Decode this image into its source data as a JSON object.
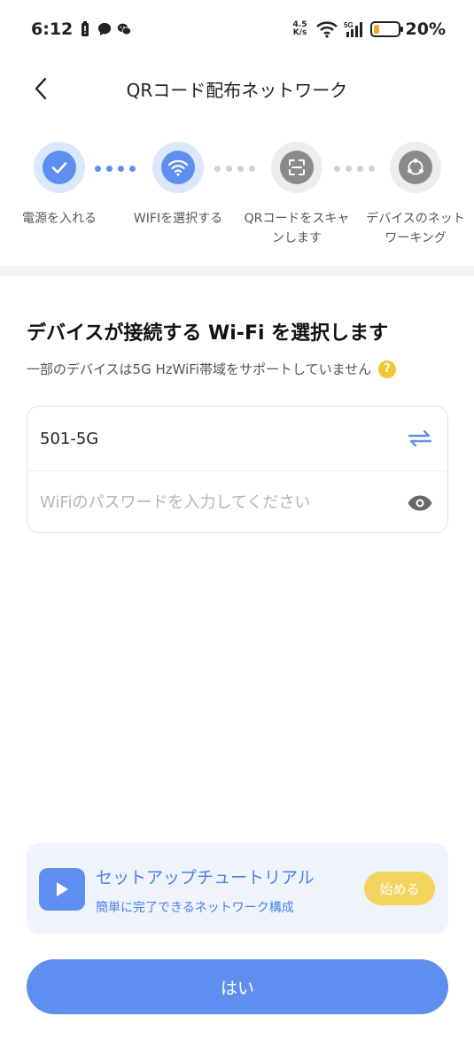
{
  "status_bar": {
    "time": "6:12",
    "net_speed_value": "4.5",
    "net_speed_unit": "K/s",
    "battery_percent": "20%",
    "battery_level": 0.2,
    "battery_color": "#f5a623"
  },
  "header": {
    "title": "QRコード配布ネットワーク"
  },
  "stepper": {
    "steps": [
      {
        "label": "電源を入れる",
        "icon": "check-icon",
        "state": "done"
      },
      {
        "label": "WIFIを選択する",
        "icon": "wifi-icon",
        "state": "active"
      },
      {
        "label": "QRコードをスキャンします",
        "label_line1": "QRコードをスキャ",
        "label_line2": "ンします",
        "icon": "scan-icon",
        "state": "pending"
      },
      {
        "label": "デバイスのネットワーキング",
        "label_line1": "デバイスのネット",
        "label_line2": "ワーキング",
        "icon": "network-icon",
        "state": "pending"
      }
    ]
  },
  "wifi": {
    "title": "デバイスが接続する Wi-Fi を選択します",
    "note": "一部のデバイスは5G HzWiFi帯域をサポートしていません",
    "ssid": "501-5G",
    "password_placeholder": "WiFiのパスワードを入力してください"
  },
  "tutorial": {
    "title": "セットアップチュートリアル",
    "subtitle": "簡単に完了できるネットワーク構成",
    "start_label": "始める"
  },
  "confirm_label": "はい",
  "colors": {
    "accent": "#5e8ff0",
    "accent_light": "#dbe7fb",
    "warning": "#f4d35e",
    "inactive": "#8a8a8a"
  }
}
